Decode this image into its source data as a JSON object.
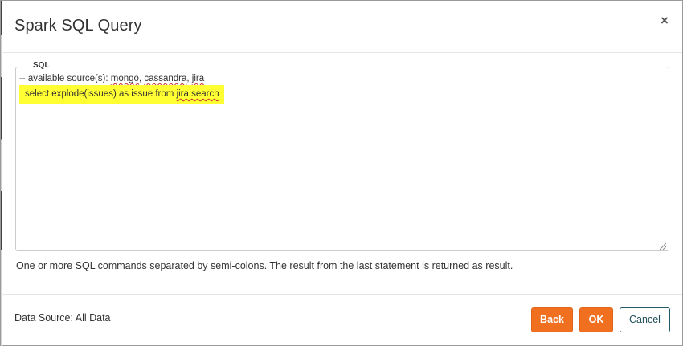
{
  "dialog": {
    "title": "Spark SQL Query",
    "close_label": "×"
  },
  "sql_field": {
    "legend": "SQL",
    "lines": [
      {
        "prefix": "-- available source(s): ",
        "sources": [
          "mongo",
          ", ",
          "cassandra",
          ", ",
          "jira"
        ]
      },
      {
        "prefix": "select explode(issues) as issue from ",
        "table": "jira.search"
      }
    ],
    "help_text": "One or more SQL commands separated by semi-colons. The result from the last statement is returned as result.",
    "highlight_color": "#ffff33"
  },
  "footer": {
    "data_source": "Data Source: All Data",
    "back_label": "Back",
    "ok_label": "OK",
    "cancel_label": "Cancel"
  },
  "colors": {
    "primary_button": "#f07020",
    "cancel_border": "#1f5a66"
  }
}
